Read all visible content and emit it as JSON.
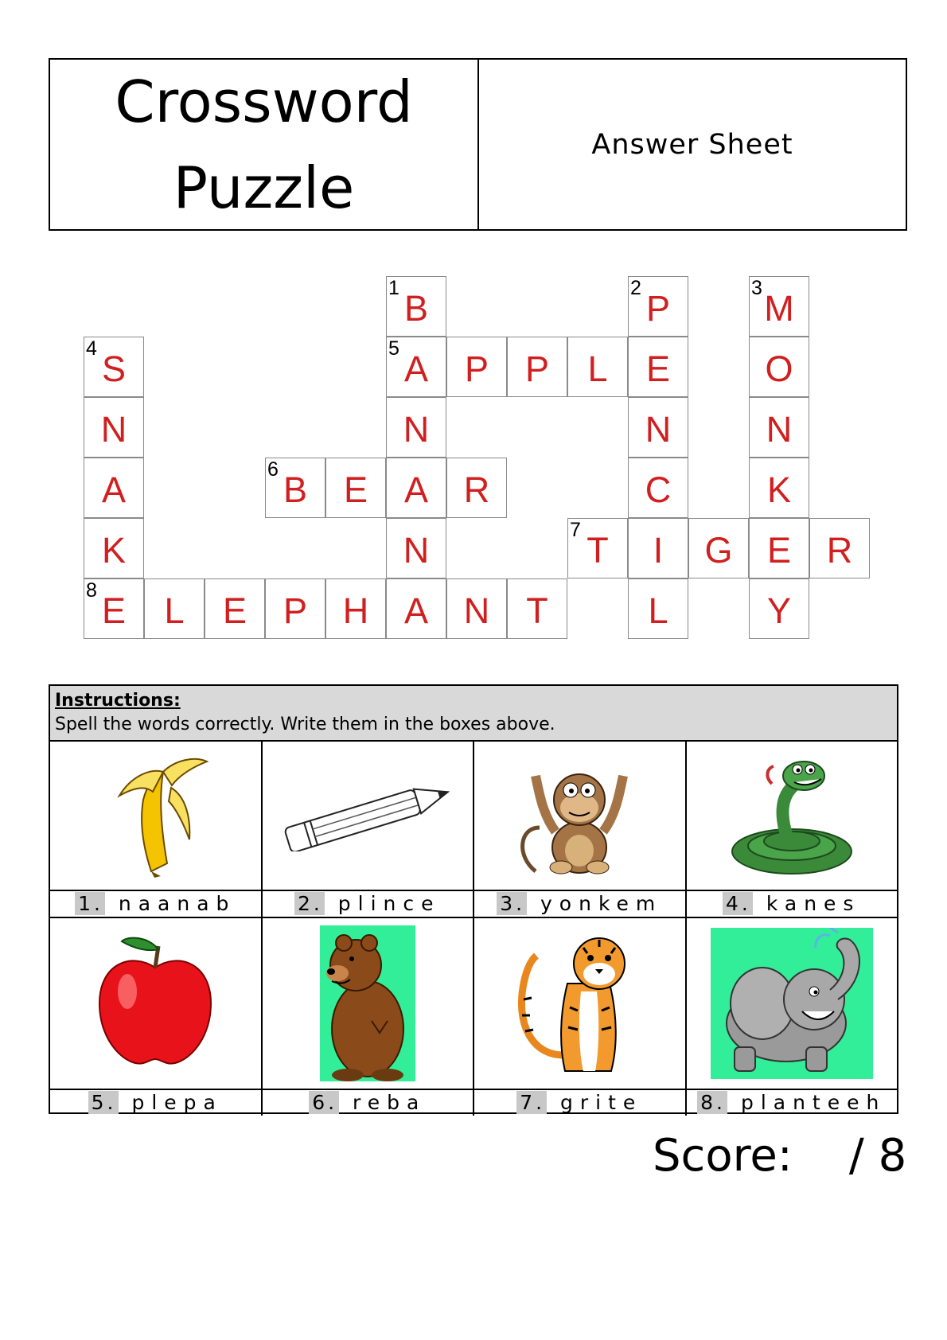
{
  "header": {
    "title_line1": "Crossword",
    "title_line2": "Puzzle",
    "subtitle": "Answer Sheet"
  },
  "crossword": {
    "numbers": [
      "1",
      "2",
      "3",
      "4",
      "5",
      "6",
      "7",
      "8"
    ],
    "answers": {
      "down_1": "BANANA",
      "down_2": "PENCIL",
      "down_3": "MONKEY",
      "down_4": "SNAKE",
      "across_5": "APPLE",
      "across_6": "BEAR",
      "across_7": "TIGER",
      "across_8": "ELEPHANT"
    }
  },
  "instructions": {
    "title": "Instructions:",
    "text": "Spell the words correctly. Write them in the boxes above."
  },
  "clues": [
    {
      "num": "1.",
      "scrambled": "naanab",
      "picture": "banana-icon"
    },
    {
      "num": "2.",
      "scrambled": "plince",
      "picture": "pencil-icon"
    },
    {
      "num": "3.",
      "scrambled": "yonkem",
      "picture": "monkey-icon"
    },
    {
      "num": "4.",
      "scrambled": "kanes",
      "picture": "snake-icon"
    },
    {
      "num": "5.",
      "scrambled": "plepa",
      "picture": "apple-icon"
    },
    {
      "num": "6.",
      "scrambled": "reba",
      "picture": "bear-icon"
    },
    {
      "num": "7.",
      "scrambled": "grite",
      "picture": "tiger-icon"
    },
    {
      "num": "8.",
      "scrambled": "planteeh",
      "picture": "elephant-icon"
    }
  ],
  "score": {
    "label": "Score:",
    "total": "/ 8"
  },
  "colors": {
    "answer_letters": "#d11f1f",
    "grid_border": "#8a8a8a",
    "instruction_band": "#d9d9d9",
    "number_highlight": "#c8c8c8",
    "picture_bg": "#33ee99"
  }
}
